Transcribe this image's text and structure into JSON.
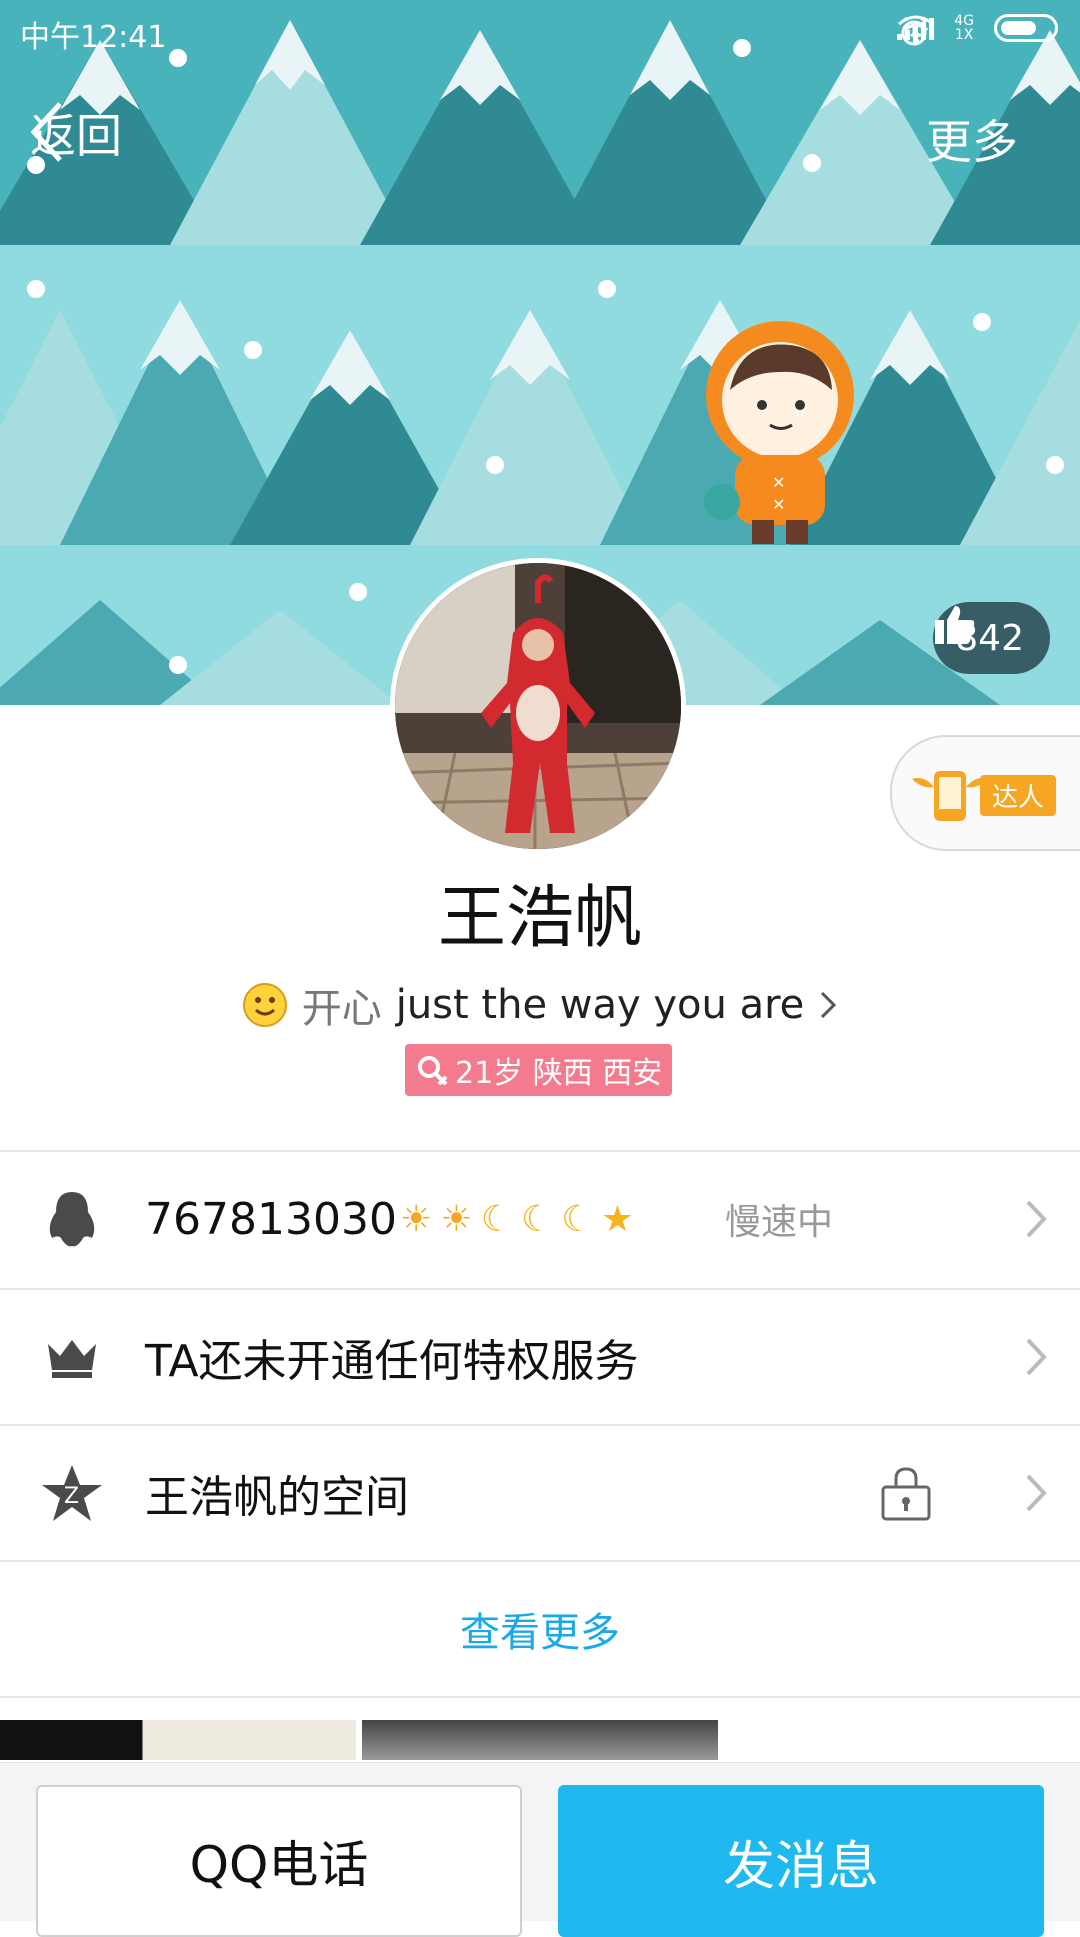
{
  "status": {
    "time": "中午12:41",
    "network_top": "4G",
    "network_bottom": "1X"
  },
  "nav": {
    "back_label": "返回",
    "more_label": "更多"
  },
  "likes": {
    "count": "842"
  },
  "daren": {
    "label": "达人"
  },
  "profile": {
    "name": "王浩帆",
    "mood_label": "开心",
    "signature": "just the way you are",
    "info": "21岁 陕西 西安"
  },
  "rows": {
    "qq": {
      "number": "767813030",
      "levels": [
        "sun",
        "sun",
        "moon",
        "moon",
        "moon",
        "star"
      ],
      "speed": "慢速中"
    },
    "vip": {
      "text": "TA还未开通任何特权服务"
    },
    "zone": {
      "text": "王浩帆的空间"
    }
  },
  "see_more": "查看更多",
  "actions": {
    "call": "QQ电话",
    "message": "发消息"
  },
  "colors": {
    "accent": "#1fb8ef",
    "link": "#1aa8e8",
    "banner": "#8fdbe0",
    "badge": "#f47a8e"
  }
}
